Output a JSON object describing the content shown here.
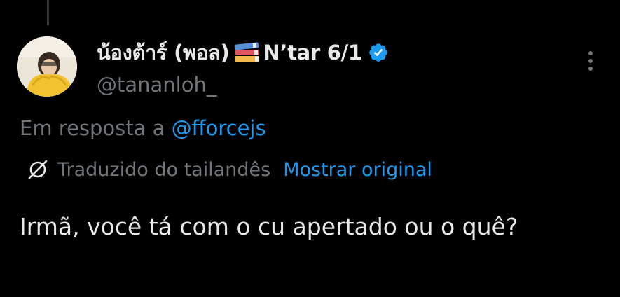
{
  "post": {
    "author": {
      "display_name": "น้องต้าร์ (พอล)",
      "display_name_suffix": "N’tar 6/1",
      "handle": "@tananloh_",
      "emoji_icon": "books-icon",
      "verified_icon": "verified-badge-icon",
      "verified_color": "#1d9bf0"
    },
    "reply_context": {
      "prefix": "Em resposta a",
      "mention": "@fforcejs"
    },
    "translation": {
      "label": "Traduzido do tailandês",
      "show_original": "Mostrar original"
    },
    "text": "Irmã, você tá com o cu apertado ou o quê?"
  },
  "icons": {
    "more": "more-vertical-icon",
    "translate": "translate-icon"
  },
  "colors": {
    "background": "#000000",
    "primary_text": "#e7e9ea",
    "secondary_text": "#71767b",
    "accent": "#1d9bf0"
  }
}
